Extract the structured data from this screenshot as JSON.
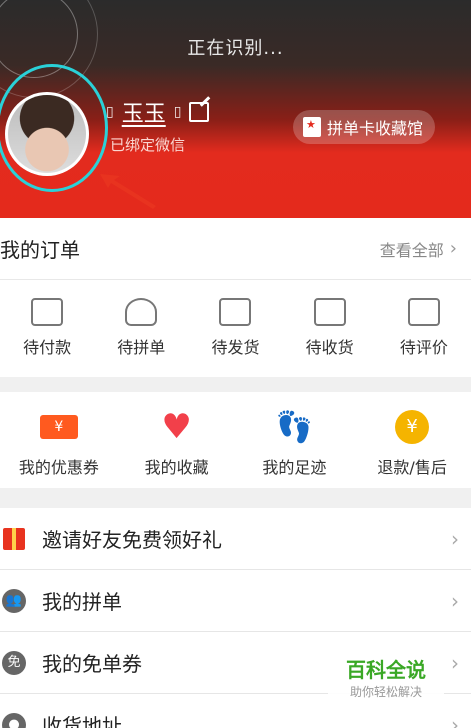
{
  "header": {
    "status_text": "正在识别...",
    "username": "玉玉",
    "wechat_status": "已绑定微信",
    "collect_button": "拼单卡收藏馆"
  },
  "orders": {
    "title": "我的订单",
    "view_all": "查看全部",
    "items": [
      {
        "label": "待付款",
        "icon": "wallet-icon"
      },
      {
        "label": "待拼单",
        "icon": "group-icon"
      },
      {
        "label": "待发货",
        "icon": "box-icon"
      },
      {
        "label": "待收货",
        "icon": "truck-icon"
      },
      {
        "label": "待评价",
        "icon": "edit-icon"
      }
    ]
  },
  "features": {
    "items": [
      {
        "label": "我的优惠券",
        "icon": "coupon-icon",
        "symbol": "¥"
      },
      {
        "label": "我的收藏",
        "icon": "heart-icon"
      },
      {
        "label": "我的足迹",
        "icon": "footprint-icon"
      },
      {
        "label": "退款/售后",
        "icon": "refund-icon",
        "symbol": "¥"
      }
    ]
  },
  "menu": {
    "items": [
      {
        "label": "邀请好友免费领好礼",
        "icon": "gift-icon"
      },
      {
        "label": "我的拼单",
        "icon": "group-icon"
      },
      {
        "label": "我的免单券",
        "icon": "free-coupon-icon",
        "badge": "免"
      },
      {
        "label": "收货地址",
        "icon": "location-icon"
      }
    ]
  },
  "watermark": {
    "title": "百科全说",
    "subtitle": "助你轻松解决"
  },
  "colors": {
    "brand_red": "#e32b1e",
    "highlight_ring": "#2ad1d8",
    "watermark_green": "#3aa826"
  }
}
